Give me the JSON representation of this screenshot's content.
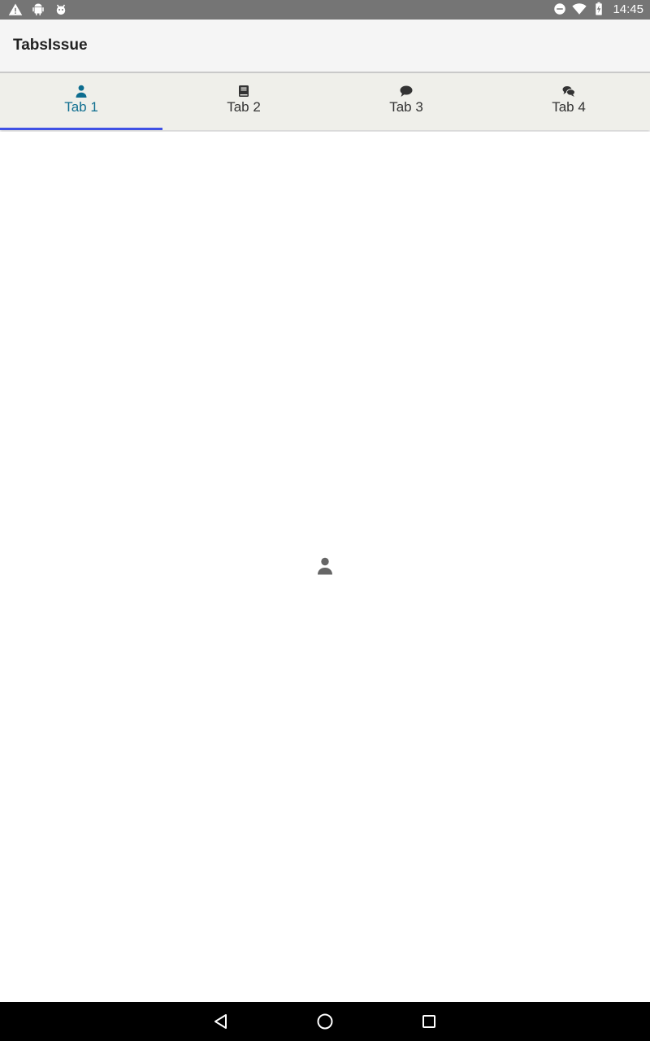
{
  "status_bar": {
    "time": "14:45",
    "left_icons": [
      "warning-icon",
      "android-icon",
      "bug-icon"
    ],
    "right_icons": [
      "do-not-disturb-icon",
      "wifi-icon",
      "battery-charging-icon"
    ]
  },
  "app_bar": {
    "title": "TabsIssue"
  },
  "tabs": [
    {
      "label": "Tab 1",
      "icon": "person-icon",
      "selected": true
    },
    {
      "label": "Tab 2",
      "icon": "book-icon",
      "selected": false
    },
    {
      "label": "Tab 3",
      "icon": "chat-bubble-icon",
      "selected": false
    },
    {
      "label": "Tab 4",
      "icon": "chat-bubbles-icon",
      "selected": false
    }
  ],
  "content": {
    "icon": "person-icon"
  },
  "nav_bar": {
    "buttons": [
      "back-icon",
      "home-icon",
      "recents-icon"
    ]
  },
  "colors": {
    "status_bar": "#757575",
    "app_bar": "#f5f5f5",
    "tab_bar": "#efefea",
    "tab_active_text": "#0d6d8f",
    "tab_indicator": "#3f51e5",
    "nav_bar": "#000000"
  }
}
